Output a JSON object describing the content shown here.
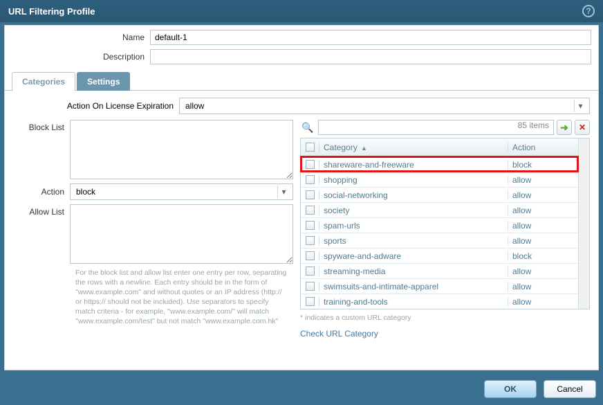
{
  "window": {
    "title": "URL Filtering Profile"
  },
  "form": {
    "name_label": "Name",
    "name_value": "default-1",
    "desc_label": "Description",
    "desc_value": ""
  },
  "tabs": {
    "categories": "Categories",
    "settings": "Settings",
    "active": "settings"
  },
  "settings": {
    "license_label": "Action On License Expiration",
    "license_value": "allow",
    "block_list_label": "Block List",
    "block_list_value": "",
    "action_label": "Action",
    "action_value": "block",
    "allow_list_label": "Allow List",
    "allow_list_value": "",
    "help_text": "For the block list and allow list enter one entry per row, separating the rows with a newline. Each entry should be in the form of \"www.example.com\" and without quotes or an IP address (http:// or https:// should not be included). Use separators to specify match criteria - for example, \"www.example.com/\" will match \"www.example.com/test\" but not match \"www.example.com.hk\""
  },
  "grid": {
    "items_count_label": "85 items",
    "col_category": "Category",
    "col_action": "Action",
    "rows": [
      {
        "category": "shareware-and-freeware",
        "action": "block",
        "highlight": true
      },
      {
        "category": "shopping",
        "action": "allow"
      },
      {
        "category": "social-networking",
        "action": "allow"
      },
      {
        "category": "society",
        "action": "allow"
      },
      {
        "category": "spam-urls",
        "action": "allow"
      },
      {
        "category": "sports",
        "action": "allow"
      },
      {
        "category": "spyware-and-adware",
        "action": "block"
      },
      {
        "category": "streaming-media",
        "action": "allow"
      },
      {
        "category": "swimsuits-and-intimate-apparel",
        "action": "allow"
      },
      {
        "category": "training-and-tools",
        "action": "allow"
      }
    ],
    "footnote": "* indicates a custom URL category",
    "check_link": "Check URL Category"
  },
  "footer": {
    "ok": "OK",
    "cancel": "Cancel"
  }
}
